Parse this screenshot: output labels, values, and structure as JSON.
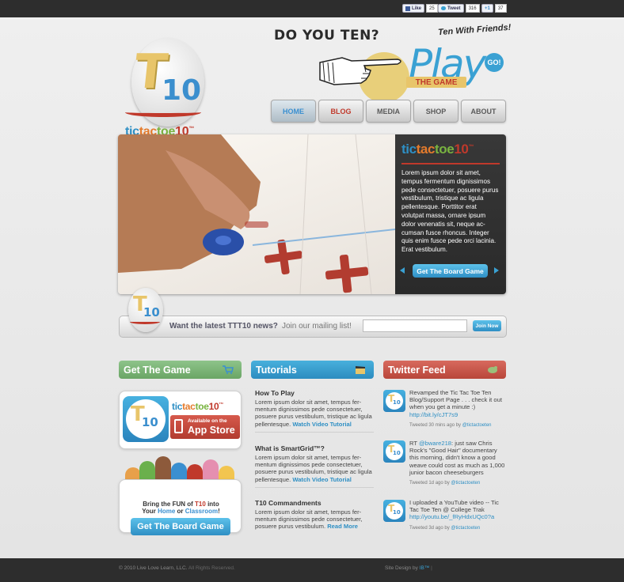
{
  "social": {
    "like": {
      "label": "Like",
      "count": "25"
    },
    "tweet": {
      "label": "Tweet",
      "count": "316"
    },
    "plus": {
      "label": "+1",
      "count": "37"
    }
  },
  "logo": {
    "t": "T",
    "ten": "10",
    "tic": "tic",
    "tac": "tac",
    "toe": "toe",
    "num": "10",
    "tm": "™"
  },
  "promo": {
    "question": "DO YOU TEN?",
    "friends": "Ten With Friends!",
    "play": "Play",
    "go": "GO!",
    "the_game": "THE GAME"
  },
  "nav": {
    "home": "HOME",
    "blog": "BLOG",
    "media": "MEDIA",
    "shop": "SHOP",
    "about": "ABOUT"
  },
  "hero": {
    "brand_tic": "tic",
    "brand_tac": "tac",
    "brand_toe": "toe",
    "brand_num": "10",
    "brand_tm": "™",
    "body": "Lorem ipsum dolor sit amet, tempus fermentum dignissimos pede consectetuer, posuere purus vestibulum, tristique ac ligula pellentesque. Porttitor erat volutpat massa, ornare ipsum dolor venenatis sit, neque ac-cumsan fusce rhoncus. Integer quis enim fusce pede orci lacinia. Erat vestibulum.",
    "cta": "Get The Board Game"
  },
  "newsletter": {
    "question": "Want the latest TTT10 news?",
    "sub": "Join our mailing list!",
    "email_placeholder": "",
    "button": "Join Now"
  },
  "columns": {
    "game": "Get The Game",
    "tutorials": "Tutorials",
    "twitter": "Twitter Feed"
  },
  "app": {
    "brand_tic": "tic",
    "brand_tac": "tac",
    "brand_toe": "toe",
    "brand_num": "10",
    "brand_tm": "™",
    "avail": "Available on the",
    "store": "App Store"
  },
  "board": {
    "line1_pre": "Bring the FUN of ",
    "line1_hl": "T10",
    "line1_post": " into",
    "line2_pre": "Your ",
    "line2_home": "Home",
    "line2_mid": " or ",
    "line2_class": "Classroom",
    "line2_post": "!",
    "button": "Get The Board Game"
  },
  "tutorials": [
    {
      "title": "How To Play",
      "body": "Lorem ipsum dolor sit amet, tempus fer-mentum dignissimos pede consectetuer, posuere purus vestibulum, tristique ac ligula pellentesque.",
      "link": "Watch Video Tutorial"
    },
    {
      "title": "What is SmartGrid™?",
      "body": "Lorem ipsum dolor sit amet, tempus fer-mentum dignissimos pede consectetuer, posuere purus vestibulum, tristique ac ligula pellentesque.",
      "link": "Watch Video Tutorial"
    },
    {
      "title": "T10 Commandments",
      "body": "Lorem ipsum dolor sit amet, tempus fer-mentum dignissimos pede consectetuer, posuere purus vestibulum.",
      "link": "Read More"
    }
  ],
  "tweets": [
    {
      "pre": "Revamped the Tic Tac Toe Ten Blog/Support Page . . . check it out when you get a minute :) ",
      "link": "http://bit.ly/cJT7s9",
      "post": "",
      "meta": "Tweeted 30 mins ago by ",
      "user": "@tictactoeten"
    },
    {
      "pre": "RT ",
      "link": "@bware218",
      "post": ": just saw Chris Rock's \"Good Hair\" documentary this morning, didn't know a good weave could cost as much as 1,000 junior bacon cheeseburgers",
      "meta": "Tweeted 1d ago by ",
      "user": "@tictactoeten"
    },
    {
      "pre": "I uploaded a YouTube video -- Tic Tac Toe Ten @ College Trak ",
      "link": "http://youtu.be/_fRyHdxUQc0?a",
      "post": "",
      "meta": "Tweeted 3d ago by ",
      "user": "@tictactoeten"
    }
  ],
  "footer": {
    "copyright": "© 2010 Live Love Learn, LLC.",
    "rights": "All Rights Reserved.",
    "design": "Site Design by ",
    "designer": "IB™"
  }
}
